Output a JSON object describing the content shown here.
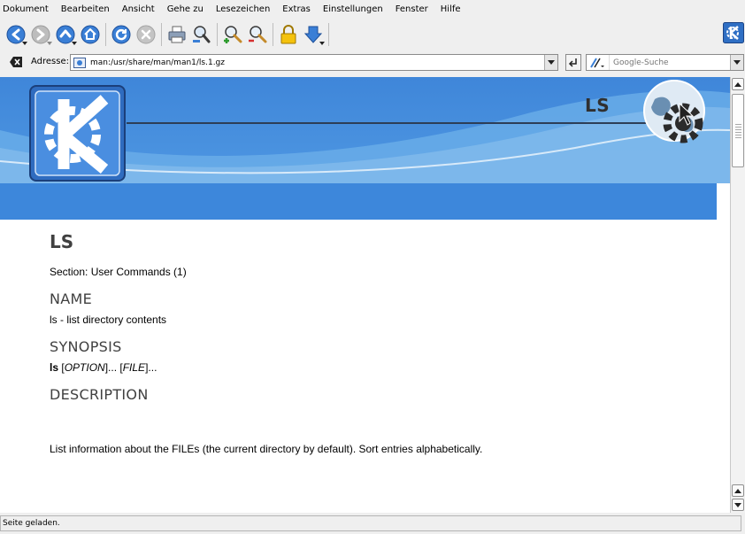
{
  "menu": [
    "Dokument",
    "Bearbeiten",
    "Ansicht",
    "Gehe zu",
    "Lesezeichen",
    "Extras",
    "Einstellungen",
    "Fenster",
    "Hilfe"
  ],
  "toolbar": {
    "buttons": [
      "back",
      "forward",
      "up",
      "home",
      "reload",
      "stop",
      "print",
      "find",
      "zoom-in",
      "zoom-out",
      "security",
      "download"
    ]
  },
  "address": {
    "label": "Adresse:",
    "url": "man:/usr/share/man/man1/ls.1.gz"
  },
  "search": {
    "placeholder": "Google-Suche"
  },
  "banner": {
    "title": "LS"
  },
  "page": {
    "title": "LS",
    "section": "Section: User Commands (1)",
    "headings": {
      "name": "NAME",
      "synopsis": "SYNOPSIS",
      "description": "DESCRIPTION"
    },
    "name_line": "ls - list directory contents",
    "synopsis": {
      "cmd": "ls",
      "open1": " [",
      "option": "OPTION",
      "close1": "]... [",
      "file": "FILE",
      "close2": "]..."
    },
    "description": "List information about the FILEs (the current directory by default). Sort entries alphabetically."
  },
  "status": "Seite geladen.",
  "colors": {
    "banner_blue": "#3d87db",
    "heading": "#404040"
  }
}
